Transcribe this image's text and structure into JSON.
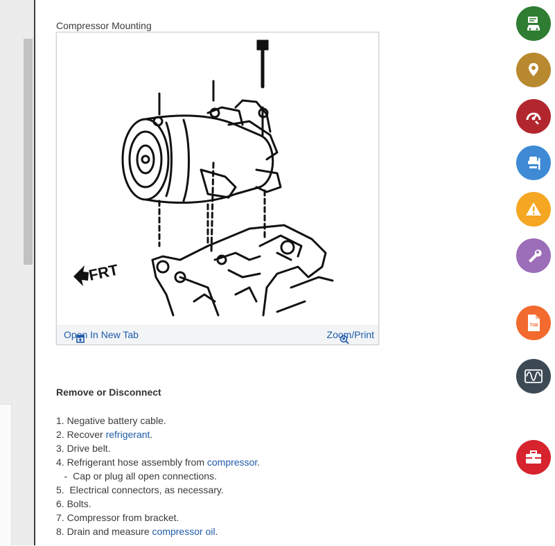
{
  "figure": {
    "caption": "Compressor Mounting",
    "frt_label": "FRT",
    "open_label": "Open In New Tab",
    "zoom_label": "Zoom/Print"
  },
  "section": {
    "title": "Remove or Disconnect",
    "steps": [
      {
        "prefix": "1. Negative battery cable.",
        "link": "",
        "suffix": ""
      },
      {
        "prefix": "2. Recover ",
        "link": "refrigerant",
        "suffix": "."
      },
      {
        "prefix": "3. Drive belt.",
        "link": "",
        "suffix": ""
      },
      {
        "prefix": "4. Refrigerant hose assembly from ",
        "link": "compressor",
        "suffix": "."
      },
      {
        "prefix": "   -  Cap or plug all open connections.",
        "link": "",
        "suffix": ""
      },
      {
        "prefix": "5.  Electrical connectors, as necessary.",
        "link": "",
        "suffix": ""
      },
      {
        "prefix": "6. Bolts.",
        "link": "",
        "suffix": ""
      },
      {
        "prefix": "7. Compressor from bracket.",
        "link": "",
        "suffix": ""
      },
      {
        "prefix": "8. Drain and measure ",
        "link": "compressor oil",
        "suffix": "."
      }
    ]
  },
  "sidebar": {
    "buttons": [
      {
        "name": "vehicle-info-button",
        "icon": "car-list-icon",
        "color": "#2e7d32"
      },
      {
        "name": "location-button",
        "icon": "map-pin-icon",
        "color": "#b8892f"
      },
      {
        "name": "diagnostics-button",
        "icon": "gauge-icon",
        "color": "#b2272d"
      },
      {
        "name": "service-lift-button",
        "icon": "vehicle-lift-icon",
        "color": "#3e8ad4"
      },
      {
        "name": "warnings-button",
        "icon": "warning-icon",
        "color": "#f5a623"
      },
      {
        "name": "repair-button",
        "icon": "wrench-icon",
        "color": "#9c6db8"
      },
      {
        "name": "tsb-button",
        "icon": "tsb-document-icon",
        "color": "#f26a2e",
        "label": "TSB"
      },
      {
        "name": "waveform-button",
        "icon": "waveform-icon",
        "color": "#3d4a56"
      },
      {
        "name": "toolbox-button",
        "icon": "toolbox-icon",
        "color": "#d6232d"
      }
    ]
  }
}
